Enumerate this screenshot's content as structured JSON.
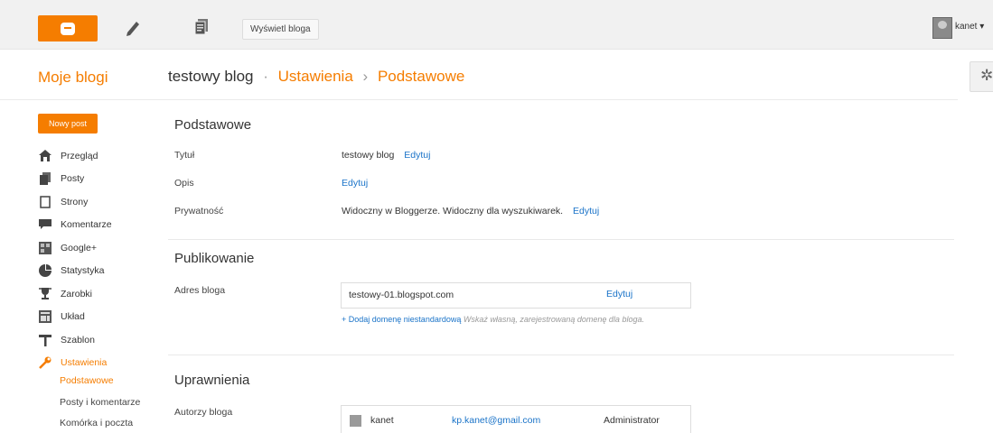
{
  "topbar": {
    "view_blog": "Wyświetl bloga",
    "user": "kanet",
    "user_caret": "▾"
  },
  "header": {
    "my_blogs": "Moje blogi",
    "blog_name": "testowy blog",
    "dot": "·",
    "settings": "Ustawienia",
    "arrow": "›",
    "basic": "Podstawowe"
  },
  "sidebar": {
    "new_post": "Nowy post",
    "items": [
      {
        "label": "Przegląd",
        "icon": "house-icon"
      },
      {
        "label": "Posty",
        "icon": "posts-icon"
      },
      {
        "label": "Strony",
        "icon": "pages-icon"
      },
      {
        "label": "Komentarze",
        "icon": "comments-icon"
      },
      {
        "label": "Google+",
        "icon": "googleplus-icon"
      },
      {
        "label": "Statystyka",
        "icon": "stats-icon"
      },
      {
        "label": "Zarobki",
        "icon": "trophy-icon"
      },
      {
        "label": "Układ",
        "icon": "layout-icon"
      },
      {
        "label": "Szablon",
        "icon": "template-icon"
      },
      {
        "label": "Ustawienia",
        "icon": "wrench-icon"
      }
    ],
    "sub_items": [
      "Podstawowe",
      "Posty i komentarze",
      "Komórka i poczta"
    ]
  },
  "basic": {
    "section_title": "Podstawowe",
    "title_label": "Tytuł",
    "title_value": "testowy blog",
    "edit": "Edytuj",
    "description_label": "Opis",
    "privacy_label": "Prywatność",
    "privacy_value": "Widoczny w Bloggerze. Widoczny dla wyszukiwarek."
  },
  "publishing": {
    "section_title": "Publikowanie",
    "address_label": "Adres bloga",
    "address_value": "testowy-01.blogspot.com",
    "edit": "Edytuj",
    "add_domain_link": "+ Dodaj domenę niestandardową",
    "add_domain_help": "Wskaż własną, zarejestrowaną domenę dla bloga."
  },
  "permissions": {
    "section_title": "Uprawnienia",
    "authors_label": "Autorzy bloga",
    "authors": [
      {
        "name": "kanet",
        "email": "kp.kanet@gmail.com",
        "role": "Administrator"
      }
    ]
  },
  "colors": {
    "accent": "#f57d00",
    "link": "#1a73c8"
  }
}
